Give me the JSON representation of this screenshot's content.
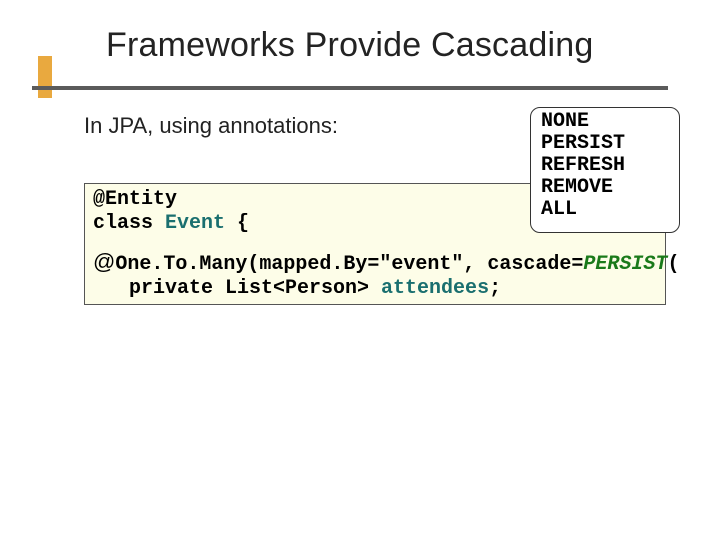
{
  "title": "Frameworks Provide Cascading",
  "subtitle": "In JPA, using annotations:",
  "enums": {
    "e0": "NONE",
    "e1": "PERSIST",
    "e2": "REFRESH",
    "e3": "REMOVE",
    "e4": "ALL"
  },
  "code": {
    "l1_a": "@Entity",
    "l2_a": "class ",
    "l2_b": "Event",
    "l2_c": " {",
    "l3_at": "@",
    "l3_a": "One.To.Many(mapped.By=\"event\", cascade=",
    "l3_b": "PERSIST",
    "l3_c": "(",
    "l4_a": "   private List<Person> ",
    "l4_b": "attendees",
    "l4_c": ";"
  }
}
